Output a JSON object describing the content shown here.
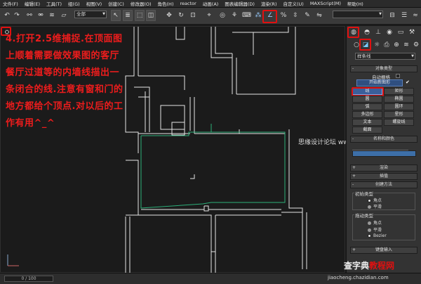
{
  "menubar": {
    "items": [
      "文件(F)",
      "编辑(E)",
      "工具(T)",
      "组(G)",
      "视图(V)",
      "创建(C)",
      "修改器(O)",
      "角色(H)",
      "reactor",
      "动画(A)",
      "图表编辑器(D)",
      "渲染(R)",
      "自定义(U)",
      "MAXScript(M)",
      "帮助(H)"
    ]
  },
  "toolbar": {
    "selection_filter": "全部",
    "snap_toggle_label": "2.5"
  },
  "viewport": {
    "instruction_text": "4.打开2.5维捕捉.在顶面图上顺着需要做效果图的客厅餐厅过道等的内墙线描出一条闭合的线.注意有窗和门的地方都给个顶点.对以后的工作有用^_^",
    "watermark_site": "思缘设计论坛 www.missyuan.com",
    "accent_line_color": "#2db07a",
    "wall_color": "#e6e6e6",
    "highlight_color": "#e01010"
  },
  "command_panel": {
    "category_dropdown": "样条线",
    "object_type_rollout": "对象类型",
    "auto_grid": "自动栅格",
    "start_new_shape": "开始新图形",
    "object_buttons": [
      "线",
      "矩形",
      "圆",
      "椭圆",
      "弧",
      "圆环",
      "多边形",
      "星形",
      "文本",
      "螺旋线",
      "截面"
    ],
    "name_color_rollout": "名称和颜色",
    "render_rollout": "渲染",
    "interpolation_rollout": "插值",
    "creation_method_rollout": "创建方法",
    "initial_type_label": "初始类型",
    "initial_type_options": [
      "角点",
      "平滑"
    ],
    "drag_type_label": "拖动类型",
    "drag_type_options": [
      "角点",
      "平滑",
      "Bezier"
    ],
    "keyboard_entry_rollout": "键盘输入"
  },
  "statusbar": {
    "time_slider": "0 / 100"
  },
  "footer_watermark": {
    "brand_white": "查字典",
    "brand_red": "教程网",
    "url": "jiaocheng.chazidian.com"
  }
}
